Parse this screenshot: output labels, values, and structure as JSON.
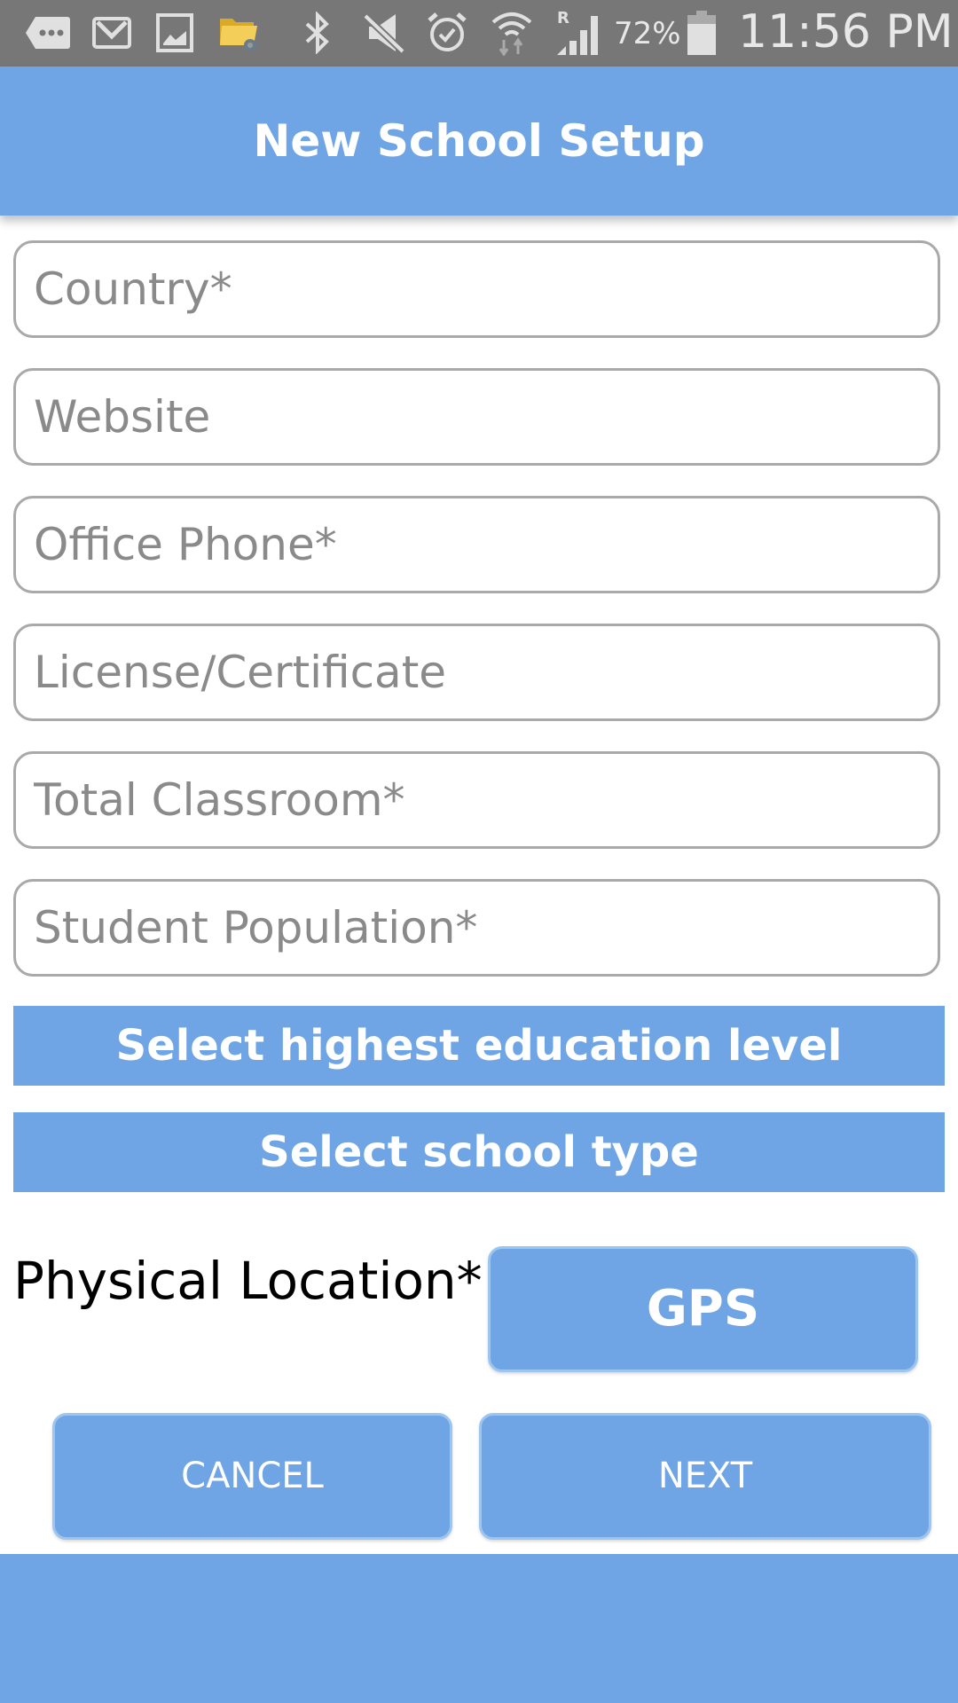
{
  "status_bar": {
    "icons": [
      "more-notifications-icon",
      "gmail-icon",
      "gallery-icon",
      "file-manager-icon",
      "bluetooth-icon",
      "mute-icon",
      "alarm-icon",
      "wifi-icon",
      "signal-roaming-icon",
      "battery-icon"
    ],
    "roaming_indicator": "R",
    "battery_percent": "72%",
    "time": "11:56 PM"
  },
  "app_bar": {
    "title": "New School Setup"
  },
  "form": {
    "fields": [
      {
        "name": "country",
        "placeholder": "Country*",
        "value": ""
      },
      {
        "name": "website",
        "placeholder": "Website",
        "value": ""
      },
      {
        "name": "office-phone",
        "placeholder": "Office Phone*",
        "value": ""
      },
      {
        "name": "license-certificate",
        "placeholder": "License/Certificate",
        "value": ""
      },
      {
        "name": "total-classroom",
        "placeholder": "Total Classroom*",
        "value": ""
      },
      {
        "name": "student-population",
        "placeholder": "Student Population*",
        "value": ""
      }
    ],
    "education_level_select": "Select highest education level",
    "school_type_select": "Select school type",
    "physical_location_label": "Physical Location*",
    "gps_button": "GPS"
  },
  "actions": {
    "cancel": "CANCEL",
    "next": "NEXT"
  },
  "colors": {
    "primary": "#6fa5e4",
    "status_bar": "#777777",
    "field_border": "#a9a9a9"
  }
}
